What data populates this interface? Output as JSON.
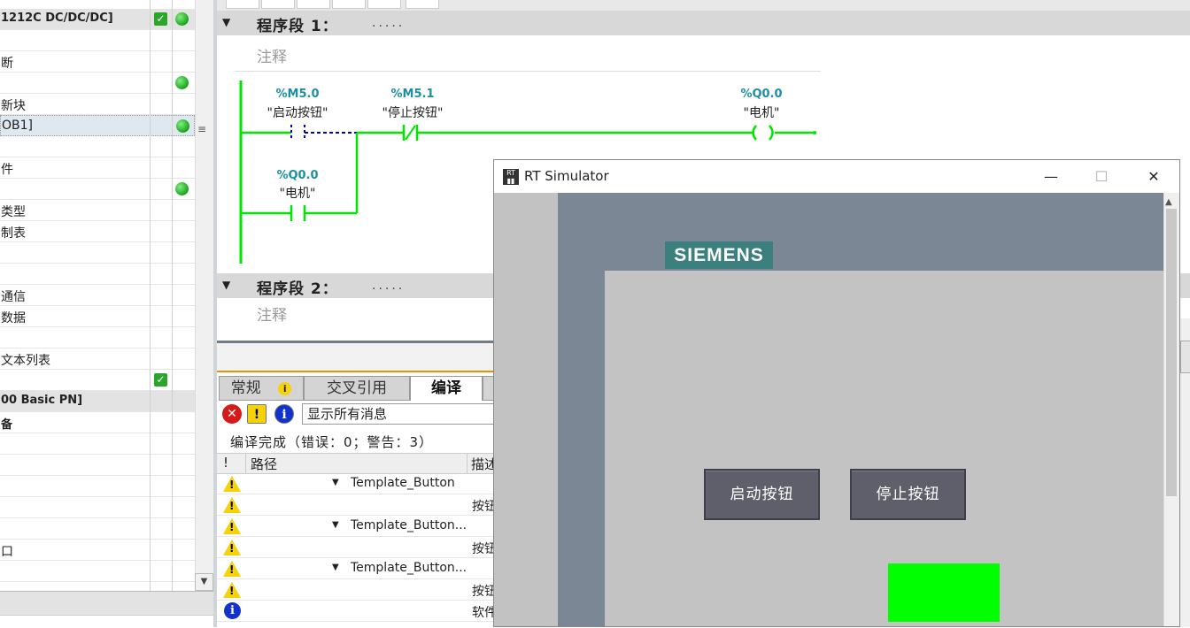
{
  "tree": {
    "rows": [
      {
        "label": "1212C DC/DC/DC]",
        "bold": true,
        "band": true,
        "check": true,
        "dot": true
      },
      {
        "label": "",
        "check": false,
        "dot": false
      },
      {
        "label": "断",
        "check": false,
        "dot": false
      },
      {
        "label": "",
        "check": false,
        "dot": true
      },
      {
        "label": "新块",
        "check": false,
        "dot": false
      },
      {
        "label": "OB1]",
        "selected": true,
        "check": false,
        "dot": true
      },
      {
        "label": "",
        "check": false,
        "dot": false
      },
      {
        "label": "件",
        "check": false,
        "dot": false
      },
      {
        "label": "",
        "check": false,
        "dot": true
      },
      {
        "label": "类型",
        "check": false,
        "dot": false
      },
      {
        "label": "制表",
        "check": false,
        "dot": false
      },
      {
        "label": "",
        "check": false,
        "dot": false
      },
      {
        "label": "",
        "check": false,
        "dot": false
      },
      {
        "label": "通信",
        "check": false,
        "dot": false
      },
      {
        "label": "数据",
        "check": false,
        "dot": false
      },
      {
        "label": "",
        "check": false,
        "dot": false
      },
      {
        "label": "文本列表",
        "check": false,
        "dot": false
      },
      {
        "label": "",
        "check": true,
        "dot": false
      },
      {
        "label": "00 Basic PN]",
        "bold": true,
        "band": true,
        "check": false,
        "dot": false
      },
      {
        "label": "备",
        "bold": true,
        "check": false,
        "dot": false
      },
      {
        "label": "",
        "check": false,
        "dot": false
      },
      {
        "label": "",
        "check": false,
        "dot": false
      },
      {
        "label": "",
        "check": false,
        "dot": false
      },
      {
        "label": "",
        "check": false,
        "dot": false
      },
      {
        "label": "",
        "check": false,
        "dot": false
      },
      {
        "label": "口",
        "check": false,
        "dot": false
      },
      {
        "label": "",
        "check": false,
        "dot": false
      }
    ]
  },
  "editor": {
    "network1": {
      "title": "程序段 1：",
      "dots": ".....",
      "comment": "注释"
    },
    "network2": {
      "title": "程序段 2：",
      "dots": ".....",
      "comment": "注释"
    },
    "contacts": {
      "m50_addr": "%M5.0",
      "m50_tag": "\"启动按钮\"",
      "m51_addr": "%M5.1",
      "m51_tag": "\"停止按钮\"",
      "q00_addr": "%Q0.0",
      "q00_tag": "\"电机\"",
      "q00b_addr": "%Q0.0",
      "q00b_tag": "\"电机\""
    }
  },
  "inspector": {
    "tabs": [
      "常规",
      "交叉引用",
      "编译"
    ],
    "active_tab": "编译",
    "filter": "显示所有消息",
    "status": "编译完成（错误：0；警告：3）",
    "headers": {
      "excl": "!",
      "path": "路径",
      "desc": "描述"
    },
    "rows": [
      {
        "type": "warning",
        "expand": "▼",
        "path": "Template_Button",
        "desc": ""
      },
      {
        "type": "warning",
        "expand": "",
        "path": "",
        "desc": "按钮"
      },
      {
        "type": "warning",
        "expand": "▼",
        "path": "Template_Button...",
        "desc": ""
      },
      {
        "type": "warning",
        "expand": "",
        "path": "",
        "desc": "按钮"
      },
      {
        "type": "warning",
        "expand": "▼",
        "path": "Template_Button...",
        "desc": ""
      },
      {
        "type": "warning",
        "expand": "",
        "path": "",
        "desc": "按钮"
      },
      {
        "type": "info",
        "expand": "",
        "path": "",
        "desc": "软件"
      }
    ]
  },
  "simulator": {
    "title": "RT Simulator",
    "logo": "SIEMENS",
    "start_button": "启动按钮",
    "stop_button": "停止按钮",
    "lamp_color": "#00ff00",
    "window_buttons": {
      "minimize": "—",
      "maximize": "☐",
      "close": "✕"
    }
  },
  "colors": {
    "rung_green": "#00e600",
    "siemens_teal": "#3c7f7f",
    "address_teal": "#1b8fa3"
  }
}
